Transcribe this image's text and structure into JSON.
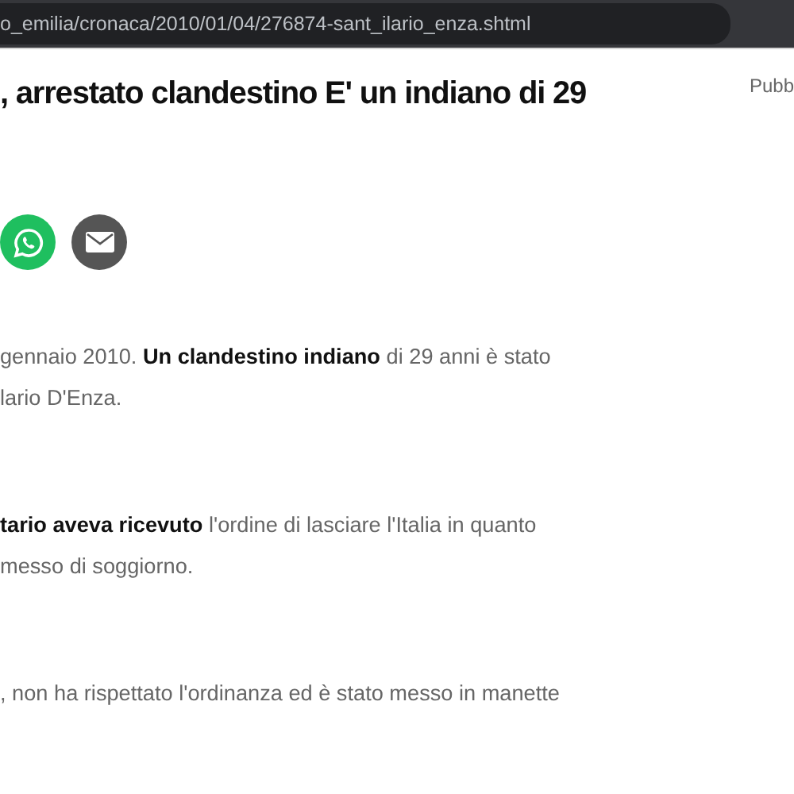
{
  "address_bar": {
    "url": "o_emilia/cronaca/2010/01/04/276874-sant_ilario_enza.shtml"
  },
  "article": {
    "title": ", arrestato clandestino E' un indiano di 29",
    "published_label": "Pubb",
    "share_buttons": [
      {
        "kind": "whatsapp"
      },
      {
        "kind": "email"
      }
    ],
    "paragraphs": [
      "gennaio 2010. **Un clandestino indiano** di 29 anni è stato\nlario D'Enza.",
      "**tario aveva ricevuto** l'ordine di lasciare l'Italia in quanto\nmesso di soggiorno.",
      ", non ha rispettato l'ordinanza ed è stato messo in manette"
    ]
  }
}
